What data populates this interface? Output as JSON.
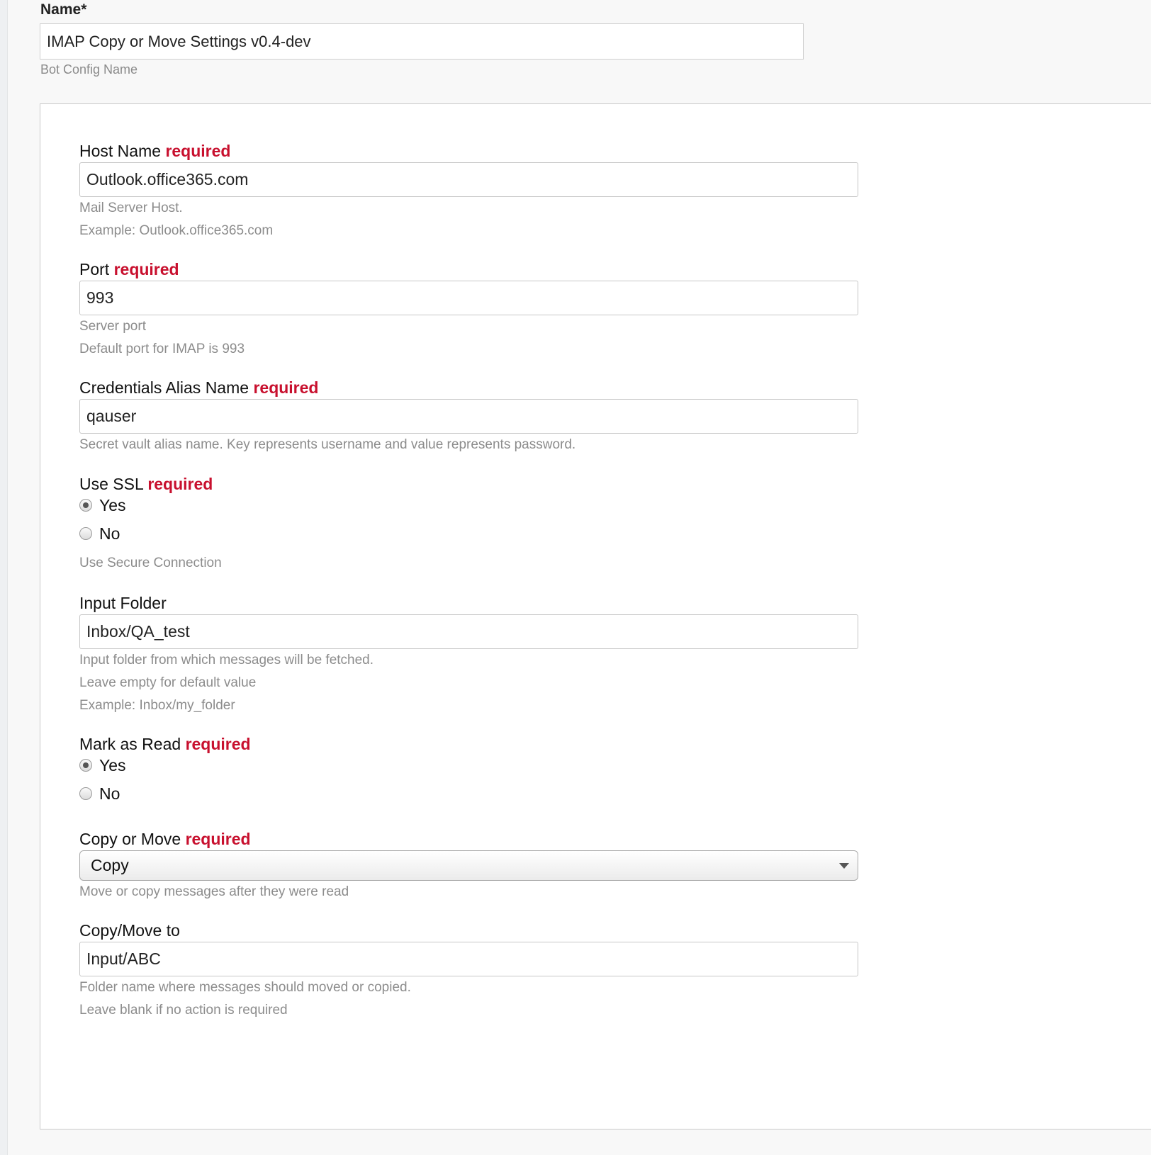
{
  "name_field": {
    "label": "Name*",
    "value": "IMAP Copy or Move Settings v0.4-dev",
    "help": "Bot Config Name"
  },
  "required_text": "required",
  "fields": {
    "host": {
      "label": "Host Name",
      "value": "Outlook.office365.com",
      "help": [
        "Mail Server Host.",
        "Example: Outlook.office365.com"
      ]
    },
    "port": {
      "label": "Port",
      "value": "993",
      "help": [
        "Server port",
        "Default port for IMAP is 993"
      ]
    },
    "credentials": {
      "label": "Credentials Alias Name",
      "value": "qauser",
      "help": [
        "Secret vault alias name. Key represents username and value represents password."
      ]
    },
    "ssl": {
      "label": "Use SSL",
      "options": [
        "Yes",
        "No"
      ],
      "selected": "Yes",
      "help": [
        "Use Secure Connection"
      ]
    },
    "input_folder": {
      "label": "Input Folder",
      "value": "Inbox/QA_test",
      "help": [
        "Input folder from which messages will be fetched.",
        "Leave empty for default value",
        "Example: Inbox/my_folder"
      ]
    },
    "mark_read": {
      "label": "Mark as Read",
      "options": [
        "Yes",
        "No"
      ],
      "selected": "Yes"
    },
    "copy_move": {
      "label": "Copy or Move",
      "selected": "Copy",
      "help": [
        "Move or copy messages after they were read"
      ]
    },
    "copy_move_to": {
      "label": "Copy/Move to",
      "value": "Input/ABC",
      "help": [
        "Folder name where messages should moved or copied.",
        "Leave blank if no action is required"
      ]
    }
  },
  "colors": {
    "required": "#c8102e",
    "help_text": "#8c8c8c",
    "background": "#f8f8f8"
  }
}
